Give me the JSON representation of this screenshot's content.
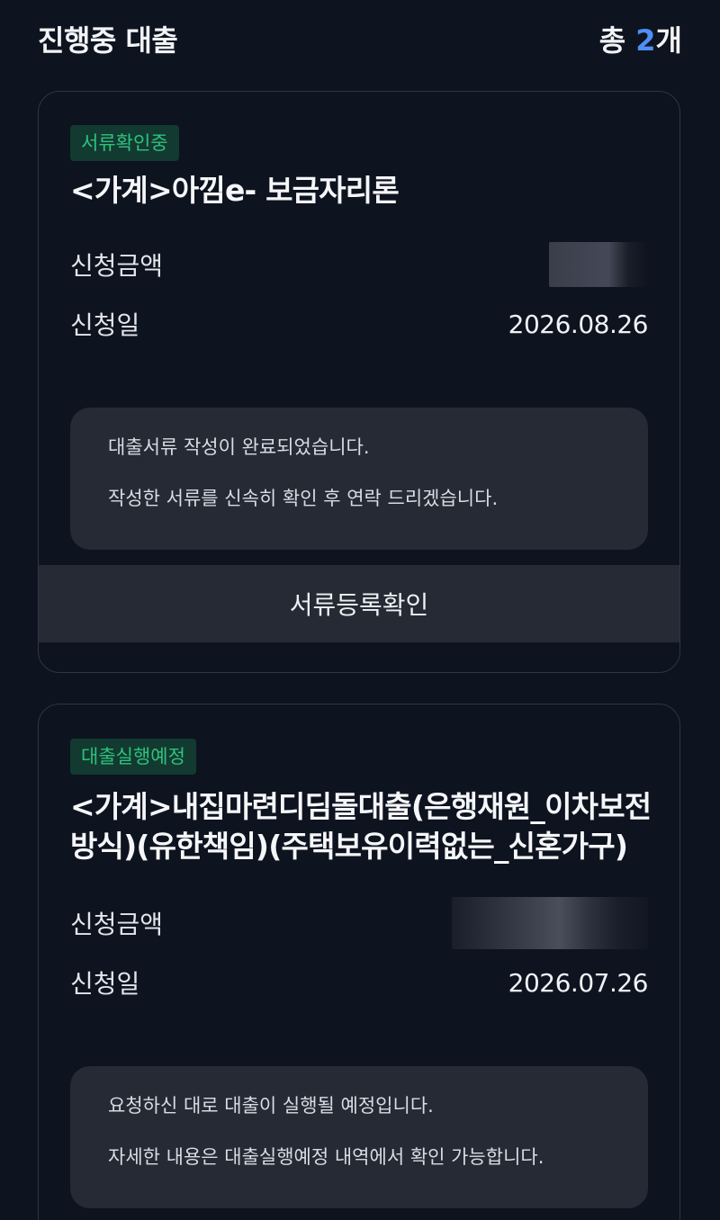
{
  "header": {
    "title": "진행중 대출",
    "count_prefix": "총",
    "count_value": "2",
    "count_suffix": "개"
  },
  "loans": [
    {
      "status_badge": "서류확인중",
      "title": "<가계>아낌e- 보금자리론",
      "amount_label": "신청금액",
      "amount_value": "",
      "date_label": "신청일",
      "date_value": "2026.08.26",
      "notice_lines": [
        "대출서류 작성이 완료되었습니다.",
        "작성한 서류를 신속히 확인 후 연락 드리겠습니다."
      ],
      "action_label": "서류등록확인"
    },
    {
      "status_badge": "대출실행예정",
      "title": "<가계>내집마련디딤돌대출(은행재원_이차보전방식)(유한책임)(주택보유이력없는_신혼가구)",
      "amount_label": "신청금액",
      "amount_value": "",
      "date_label": "신청일",
      "date_value": "2026.07.26",
      "notice_lines": [
        "요청하신 대로 대출이 실행될 예정입니다.",
        "자세한 내용은 대출실행예정 내역에서 확인 가능합니다."
      ]
    }
  ],
  "colors": {
    "background": "#0e1320",
    "accent": "#4f8ef7",
    "badge_text": "#2ec27e",
    "badge_bg": "#123a30",
    "panel": "#252a35"
  }
}
